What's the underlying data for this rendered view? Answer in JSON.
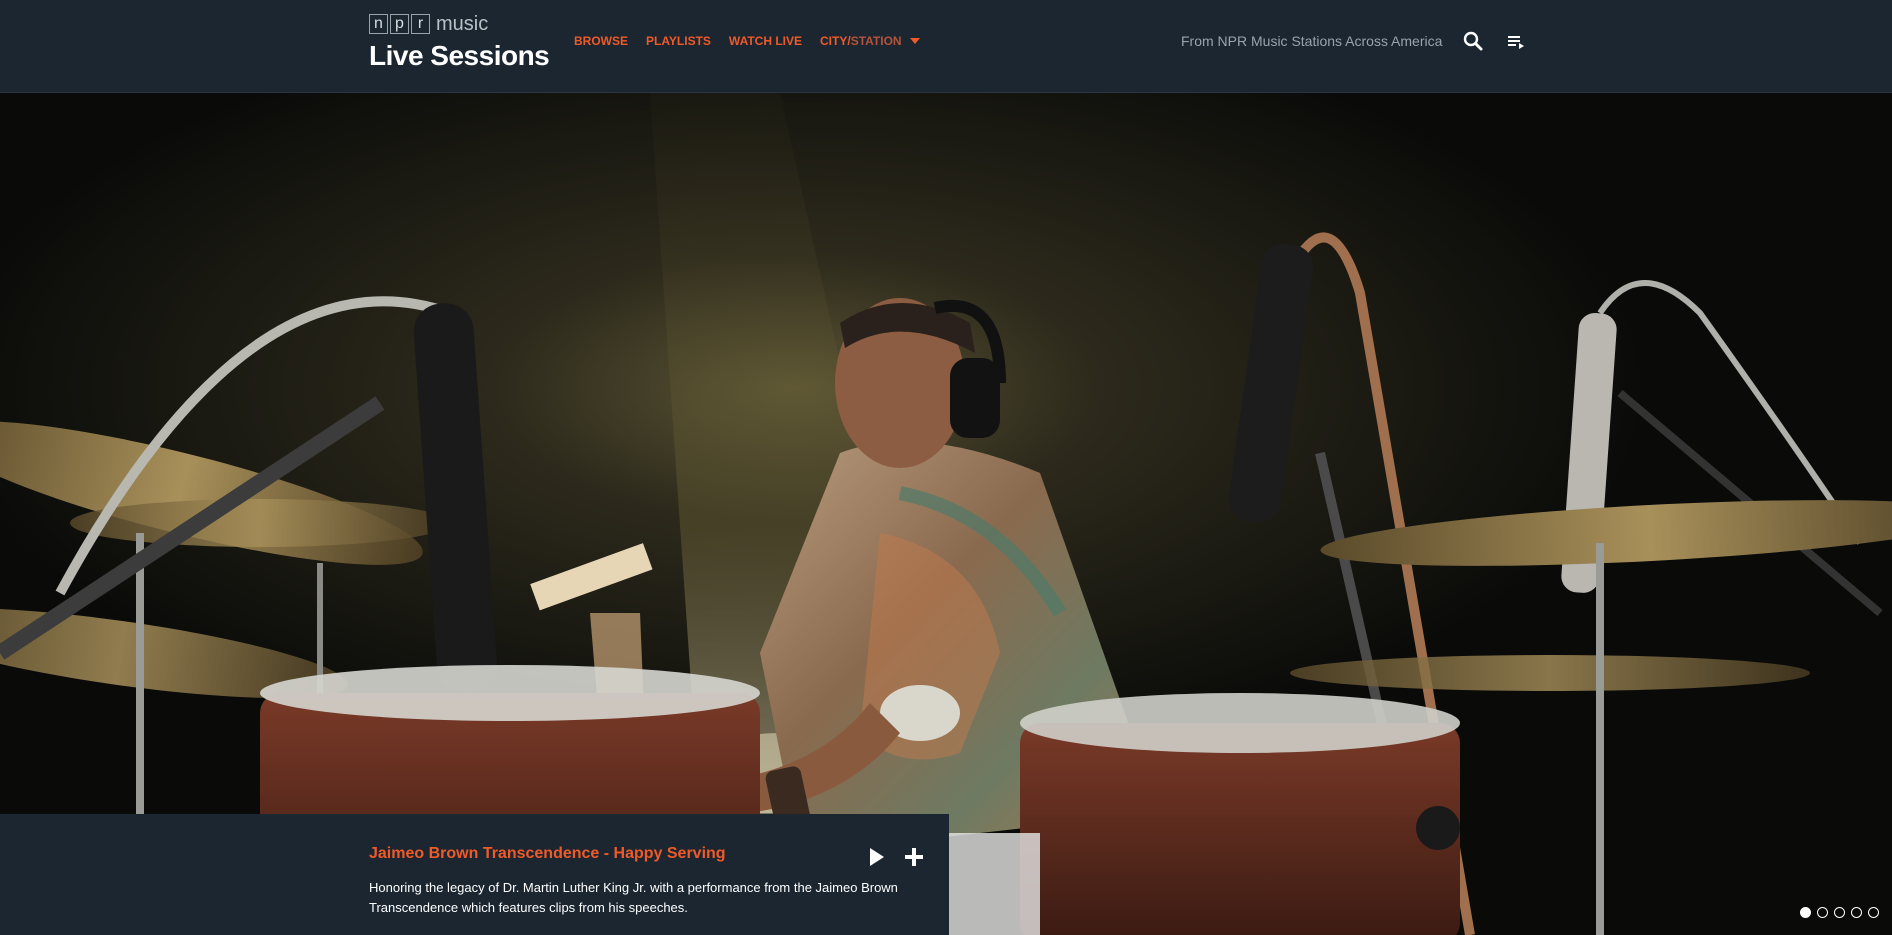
{
  "brand": {
    "logo_letters": [
      "n",
      "p",
      "r"
    ],
    "logo_suffix": "music",
    "title": "Live Sessions"
  },
  "nav": {
    "items": [
      {
        "label": "Browse"
      },
      {
        "label": "Playlists"
      },
      {
        "label": "Watch Live"
      }
    ],
    "city": {
      "label_a": "City/",
      "label_b": "Station",
      "icon": "caret-down-icon"
    }
  },
  "header": {
    "tagline": "From NPR Music Stations Across America",
    "search_icon": "search-icon",
    "queue_icon": "playlist-queue-icon"
  },
  "feature": {
    "title": "Jaimeo Brown Transcendence - Happy Serving",
    "description": "Honoring the legacy of Dr. Martin Luther King Jr. with a performance from the Jaimeo Brown Transcendence which features clips from his speeches.",
    "play_icon": "play-icon",
    "add_icon": "plus-icon"
  },
  "pagination": {
    "count": 5,
    "active_index": 0
  },
  "colors": {
    "accent": "#f05a28",
    "header_bg": "#1b2631",
    "text_light": "#ffffff",
    "text_muted": "#9aa3ab"
  }
}
